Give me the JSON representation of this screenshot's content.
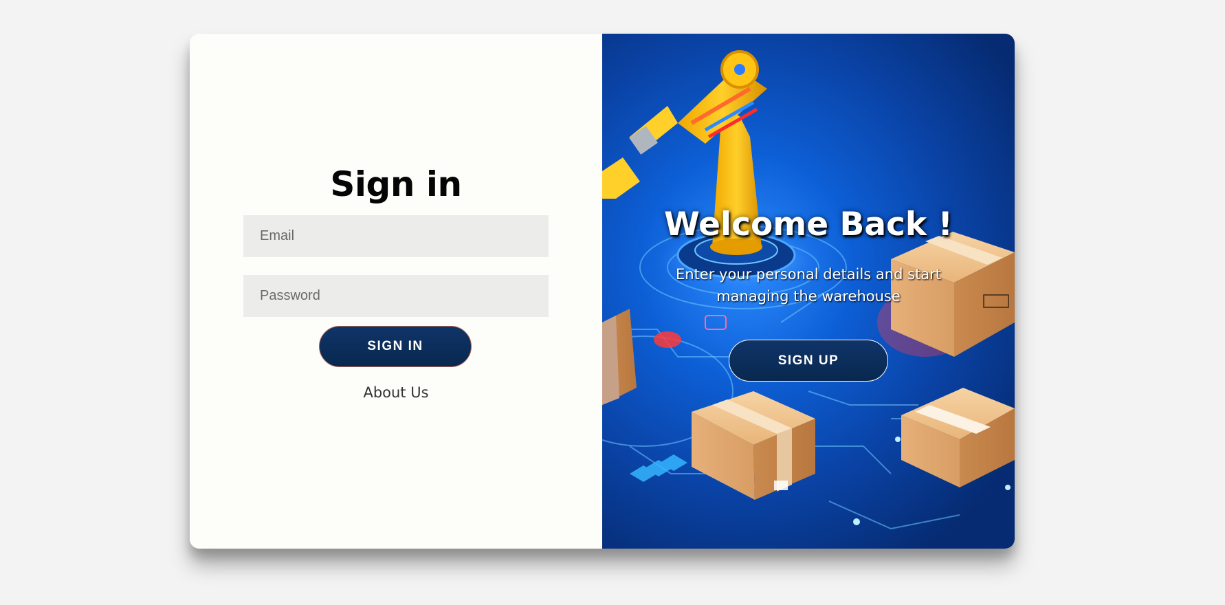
{
  "signin": {
    "title": "Sign in",
    "email_placeholder": "Email",
    "password_placeholder": "Password",
    "button_label": "SIGN IN",
    "about_link": "About Us"
  },
  "welcome": {
    "title": "Welcome Back !",
    "subtitle": "Enter your personal details and start managing the warehouse",
    "button_label": "SIGN UP"
  },
  "colors": {
    "page_background": "#f3f3f3",
    "card_background": "#fdfdf9",
    "button_navy": "#0b2e5c",
    "input_background": "#ececea",
    "hero_blue": "#0d5fd6"
  },
  "hero_image": {
    "icons": [
      "robot-arm-icon",
      "cardboard-box-icon",
      "circuit-lines-icon"
    ]
  }
}
